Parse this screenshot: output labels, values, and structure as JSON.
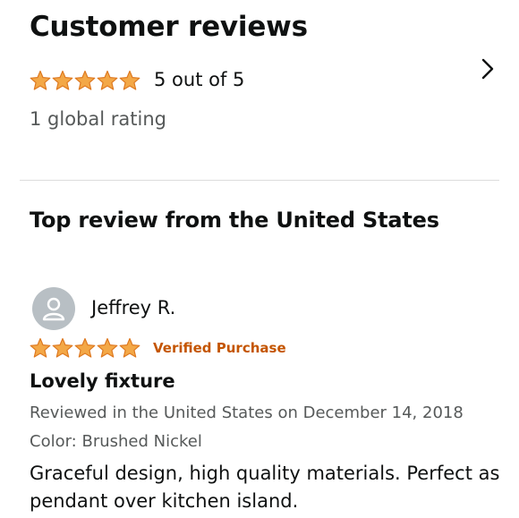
{
  "header": {
    "title": "Customer reviews",
    "rating_text": "5 out of 5",
    "global_ratings": "1 global rating",
    "stars": 5
  },
  "top_review": {
    "heading": "Top review from the United States",
    "reviewer": "Jeffrey R.",
    "stars": 5,
    "verified": "Verified Purchase",
    "title": "Lovely fixture",
    "meta": "Reviewed in the United States on December 14, 2018",
    "variant": "Color: Brushed Nickel",
    "body": "Graceful design, high quality materials. Perfect as pendant over kitchen island."
  },
  "colors": {
    "star": "#f3a847",
    "star_outline": "#de7921",
    "verified": "#c45500",
    "muted": "#565959"
  },
  "icons": {
    "chevron": "chevron-right-icon",
    "avatar": "user-avatar-icon",
    "star": "star-icon"
  }
}
